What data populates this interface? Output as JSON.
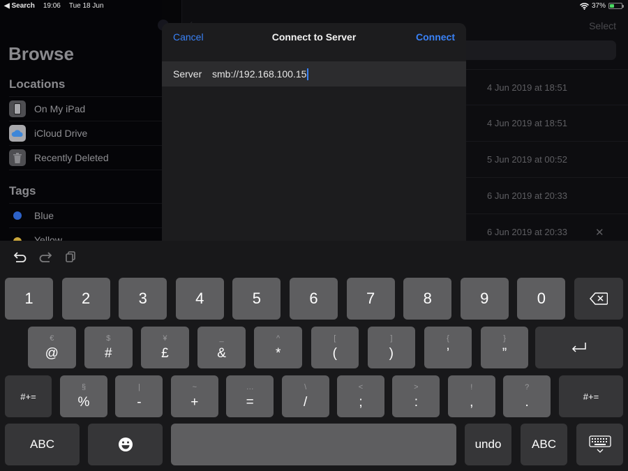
{
  "statusbar": {
    "back_label": "◀ Search",
    "time": "19:06",
    "date": "Tue 18 Jun",
    "battery_percent": "37%",
    "battery_level": 0.37,
    "battery_charging": true,
    "wifi_icon": "wifi-icon"
  },
  "sidebar": {
    "title": "Browse",
    "locations_title": "Locations",
    "locations": [
      {
        "label": "On My iPad",
        "icon": "ipad-icon"
      },
      {
        "label": "iCloud Drive",
        "icon": "icloud-icon"
      },
      {
        "label": "Recently Deleted",
        "icon": "trash-icon"
      }
    ],
    "tags_title": "Tags",
    "tags": [
      {
        "label": "Blue",
        "color": "#2d62c8"
      },
      {
        "label": "Yellow",
        "color": "#c8a43a"
      }
    ]
  },
  "main": {
    "select_label": "Select",
    "dates": [
      "4 Jun 2019 at 18:51",
      "4 Jun 2019 at 18:51",
      "5 Jun 2019 at 00:52",
      "6 Jun 2019 at 20:33",
      "6 Jun 2019 at 20:33"
    ],
    "clear_glyph": "✕"
  },
  "modal": {
    "cancel_label": "Cancel",
    "title": "Connect to Server",
    "connect_label": "Connect",
    "server_label": "Server",
    "server_value": "smb://192.168.100.15",
    "accent": "#3a82f7"
  },
  "keyboard": {
    "toolbar": [
      "undo-icon",
      "redo-icon",
      "paste-icon"
    ],
    "row1": [
      {
        "main": "1"
      },
      {
        "main": "2"
      },
      {
        "main": "3"
      },
      {
        "main": "4"
      },
      {
        "main": "5"
      },
      {
        "main": "6"
      },
      {
        "main": "7"
      },
      {
        "main": "8"
      },
      {
        "main": "9"
      },
      {
        "main": "0"
      }
    ],
    "row2": [
      {
        "alt": "€",
        "main": "@"
      },
      {
        "alt": "$",
        "main": "#"
      },
      {
        "alt": "¥",
        "main": "£"
      },
      {
        "alt": "_",
        "main": "&"
      },
      {
        "alt": "^",
        "main": "*"
      },
      {
        "alt": "[",
        "main": "("
      },
      {
        "alt": "]",
        "main": ")"
      },
      {
        "alt": "{",
        "main": "’"
      },
      {
        "alt": "}",
        "main": "”"
      }
    ],
    "row3": [
      {
        "alt": "§",
        "main": "%"
      },
      {
        "alt": "|",
        "main": "-"
      },
      {
        "alt": "~",
        "main": "+"
      },
      {
        "alt": "…",
        "main": "="
      },
      {
        "alt": "\\",
        "main": "/"
      },
      {
        "alt": "<",
        "main": ";"
      },
      {
        "alt": ">",
        "main": ":"
      },
      {
        "alt": "!",
        "main": ","
      },
      {
        "alt": "?",
        "main": "."
      }
    ],
    "symbols_label": "#+=",
    "abc_label": "ABC",
    "undo_label": "undo",
    "emoji_icon": "emoji-icon",
    "dismiss_icon": "keyboard-dismiss-icon"
  }
}
